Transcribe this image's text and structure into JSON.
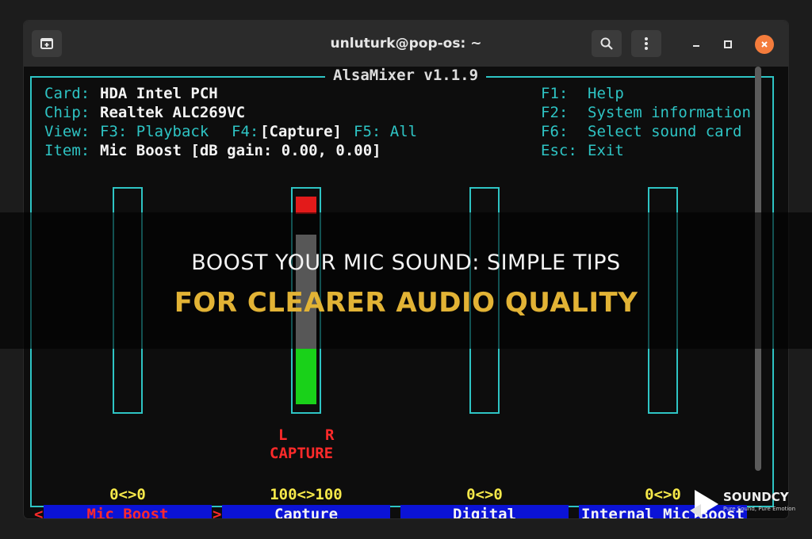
{
  "window": {
    "title": "unluturk@pop-os: ~"
  },
  "icons": {
    "new_tab": "new-tab-icon",
    "search": "search-icon",
    "menu": "kebab-menu-icon",
    "minimize": "minimize-icon",
    "maximize": "maximize-icon",
    "close": "close-icon"
  },
  "colors": {
    "accent": "#2ec4c4",
    "close": "#f47c3c",
    "highlight": "#0b13d6",
    "value": "#f7e94a",
    "selected": "#ff2a2a",
    "headline_accent": "#e2b335"
  },
  "alsamixer": {
    "title": "AlsaMixer v1.1.9",
    "card_label": "Card:",
    "card_value": "HDA Intel PCH",
    "chip_label": "Chip:",
    "chip_value": "Realtek ALC269VC",
    "view_label": "View:",
    "view_f3": "F3: Playback",
    "view_f4": "F4:",
    "view_f4_value": "[Capture]",
    "view_f5": "F5: All",
    "item_label": "Item:",
    "item_value": "Mic Boost [dB gain: 0.00, 0.00]",
    "keys": [
      {
        "key": "F1:",
        "desc": "Help"
      },
      {
        "key": "F2:",
        "desc": "System information"
      },
      {
        "key": "F6:",
        "desc": "Select sound card"
      },
      {
        "key": "Esc:",
        "desc": "Exit"
      }
    ],
    "channels": [
      {
        "name": "Mic Boost",
        "value": "0<>0",
        "selected": true,
        "level": 0
      },
      {
        "name": "Capture",
        "value": "100<>100",
        "selected": false,
        "level": 100,
        "l": "L",
        "r": "R",
        "tag": "CAPTURE"
      },
      {
        "name": "Digital",
        "value": "0<>0",
        "selected": false,
        "level": 0
      },
      {
        "name": "Internal Mic Boost",
        "value": "0<>0",
        "selected": false,
        "level": 0
      }
    ],
    "select_left": "<",
    "select_right": ">"
  },
  "headline": {
    "line1": "BOOST YOUR MIC SOUND: SIMPLE TIPS",
    "line2": "FOR CLEARER AUDIO QUALITY"
  },
  "brand": {
    "name": "SOUNDCY",
    "tagline": "Pure Sound, Pure Emotion"
  }
}
